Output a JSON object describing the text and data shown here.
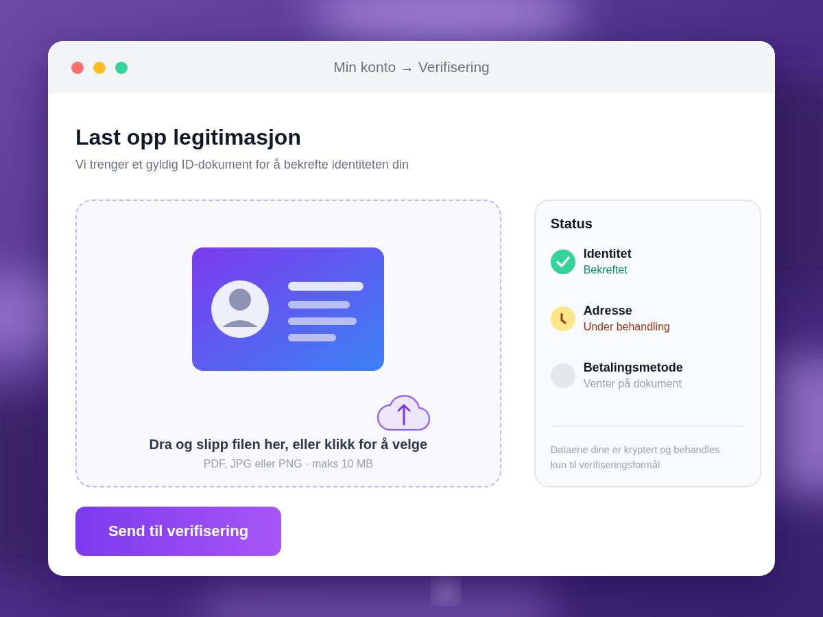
{
  "window": {
    "title": "Min konto → Verifisering"
  },
  "page": {
    "heading": "Last opp legitimasjon",
    "subtitle": "Vi trenger et gyldig ID-dokument for å bekrefte identiteten din"
  },
  "upload": {
    "prompt": "Dra og slipp filen her, eller klikk for å velge",
    "hint": "PDF, JPG eller PNG · maks 10 MB"
  },
  "submit_button": "Send til verifisering",
  "status": {
    "title": "Status",
    "items": [
      {
        "label": "Identitet",
        "state": "Bekreftet",
        "kind": "done"
      },
      {
        "label": "Adresse",
        "state": "Under behandling",
        "kind": "pending"
      },
      {
        "label": "Betalingsmetode",
        "state": "Venter på dokument",
        "kind": "waiting"
      }
    ],
    "note": "Dataene dine er kryptert og behandles kun til verifiseringsformål"
  }
}
